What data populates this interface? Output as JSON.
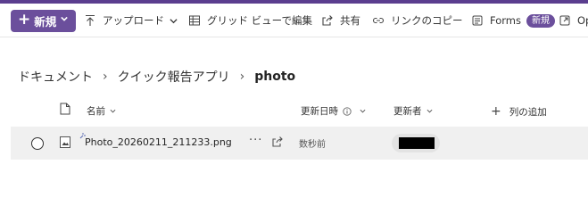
{
  "colors": {
    "accent": "#6b4f9c",
    "top_bar": "#5b3e8f",
    "row_selected_bg": "#f0f0f0"
  },
  "toolbar": {
    "new_label": "新規",
    "items": [
      {
        "label": "アップロード",
        "icon": "upload-icon"
      },
      {
        "label": "グリッド ビューで編集",
        "icon": "grid-icon"
      },
      {
        "label": "共有",
        "icon": "share-icon"
      },
      {
        "label": "リンクのコピー",
        "icon": "link-icon"
      },
      {
        "label": "Forms",
        "icon": "forms-icon",
        "badge": "新規"
      },
      {
        "label": "Op",
        "icon": "open-icon"
      }
    ]
  },
  "breadcrumb": [
    "ドキュメント",
    "クイック報告アプリ",
    "photo"
  ],
  "columns": {
    "name": "名前",
    "modified": "更新日時",
    "modified_by": "更新者",
    "add_column": "列の追加"
  },
  "rows": [
    {
      "name": "Photo_20260211_211233.png",
      "modified": "数秒前",
      "more": "···"
    }
  ]
}
